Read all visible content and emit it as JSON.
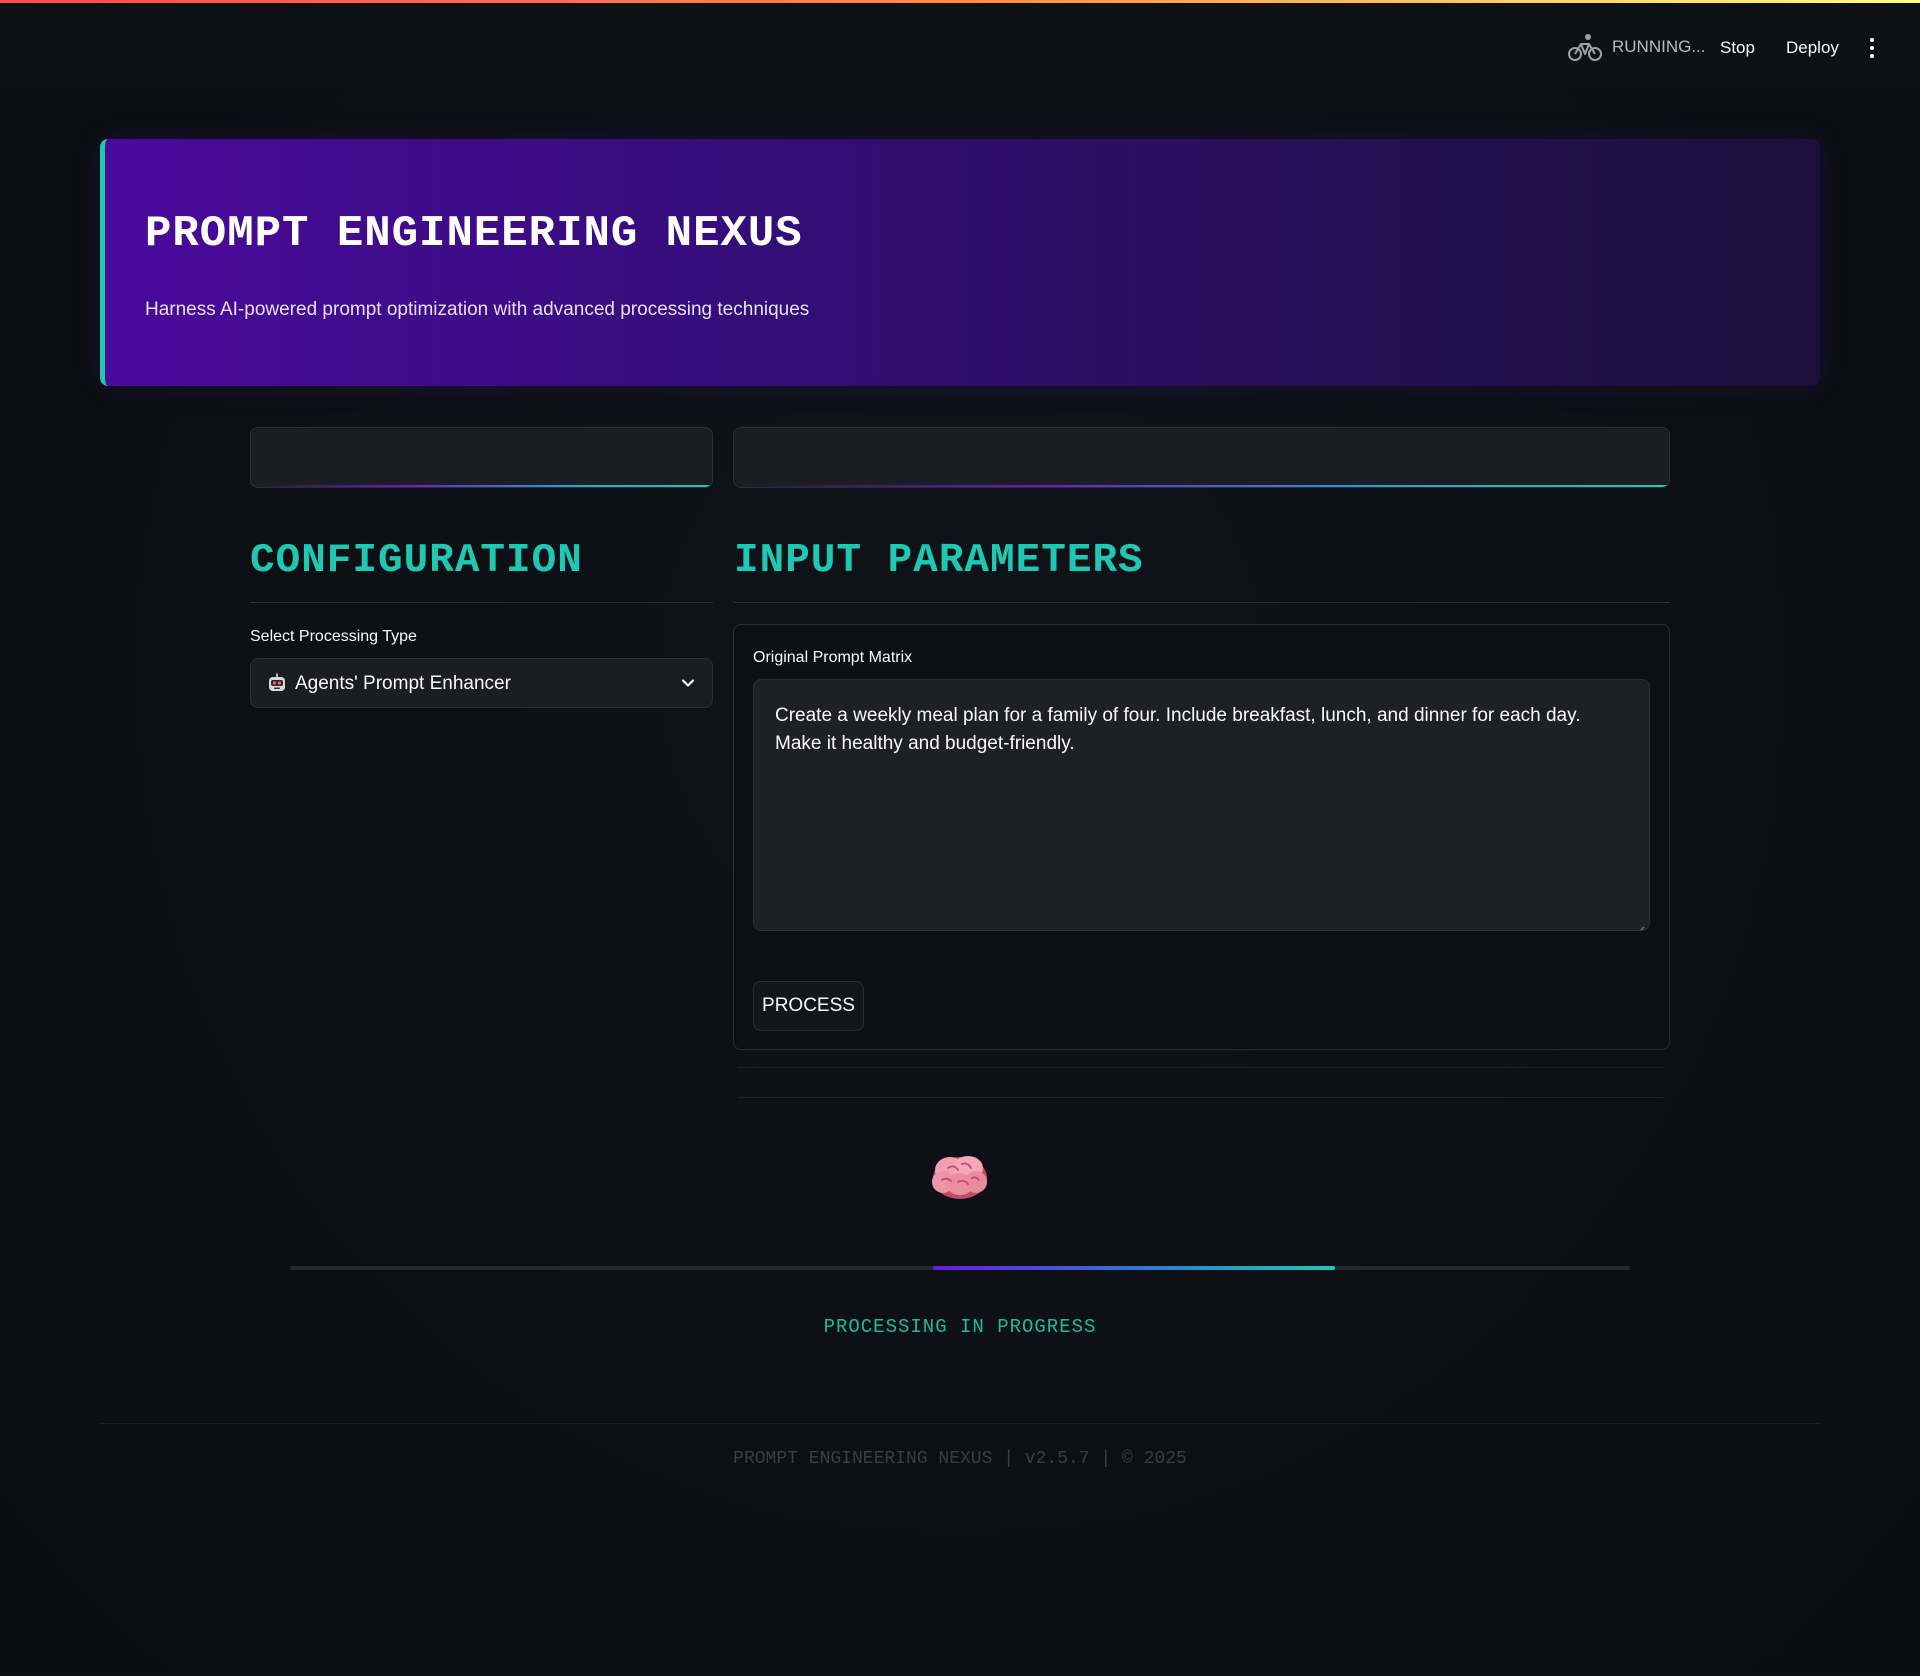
{
  "toolbar": {
    "status": "RUNNING...",
    "status_icon": "running-cyclist-icon",
    "stop_label": "Stop",
    "deploy_label": "Deploy",
    "menu_icon": "vertical-ellipsis-icon"
  },
  "hero": {
    "title": "PROMPT ENGINEERING NEXUS",
    "subtitle": "Harness AI-powered prompt optimization with advanced processing techniques"
  },
  "sections": {
    "configuration": "CONFIGURATION",
    "input_parameters": "INPUT PARAMETERS"
  },
  "config": {
    "select_label": "Select Processing Type",
    "selected_option": "Agents' Prompt Enhancer",
    "selected_icon": "robot-face-icon"
  },
  "input": {
    "textarea_label": "Original Prompt Matrix",
    "prompt_value": "Create a weekly meal plan for a family of four. Include breakfast, lunch, and dinner for each day. Make it healthy and budget-friendly.",
    "process_label": "PROCESS"
  },
  "progress": {
    "status_text": "PROCESSING IN PROGRESS",
    "icon": "brain-icon",
    "indicator_start": 0.48,
    "indicator_end": 0.78
  },
  "footer": {
    "text": "PROMPT ENGINEERING NEXUS | v2.5.7 | © 2025"
  },
  "colors": {
    "accent_teal": "#1fc9b1",
    "accent_purple": "#6a1be3",
    "hero_gradient_start": "#4a0a9c",
    "hero_gradient_end": "#1d0e3a",
    "background": "#0e1117"
  }
}
